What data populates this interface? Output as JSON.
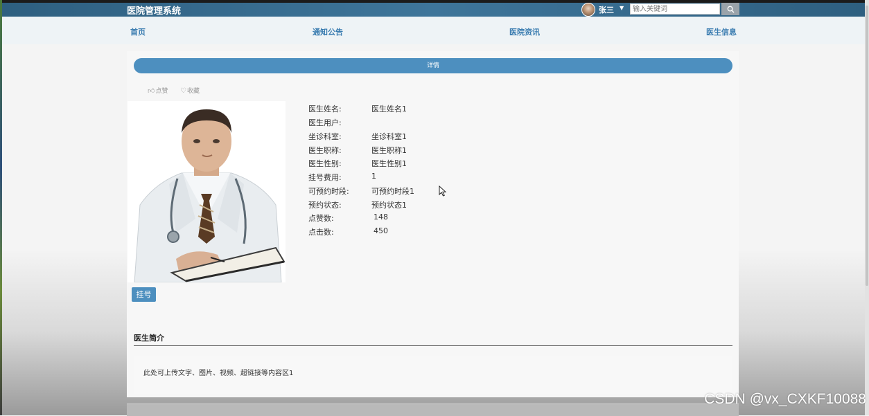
{
  "header": {
    "brand": "医院管理系统",
    "user_name": "张三",
    "search": {
      "placeholder": "输入关键词",
      "value": ""
    }
  },
  "nav": {
    "items": [
      "首页",
      "通知公告",
      "医院资讯",
      "医生信息"
    ]
  },
  "detail": {
    "tab_label": "详情",
    "actions": {
      "like": "点赞",
      "favorite": "收藏"
    },
    "fields": [
      {
        "label": "医生姓名:",
        "value": "医生姓名1"
      },
      {
        "label": "医生用户:",
        "value": ""
      },
      {
        "label": "坐诊科室:",
        "value": "坐诊科室1"
      },
      {
        "label": "医生职称:",
        "value": "医生职称1"
      },
      {
        "label": "医生性别:",
        "value": "医生性别1"
      },
      {
        "label": "挂号费用:",
        "value": "1"
      },
      {
        "label": "可预约时段:",
        "value": "可预约时段1"
      },
      {
        "label": "预约状态:",
        "value": "预约状态1"
      },
      {
        "label": "点赞数:",
        "value": "148"
      },
      {
        "label": "点击数:",
        "value": "450"
      }
    ],
    "register_button": "挂号",
    "intro_title": "医生简介",
    "intro_text": "此处可上传文字、图片、视频、超链接等内容区1"
  },
  "watermark": "CSDN @vx_CXKF10088",
  "colors": {
    "accent": "#4d8fbf",
    "topbar": "#3e759a",
    "nav_text": "#3a7cb0"
  }
}
